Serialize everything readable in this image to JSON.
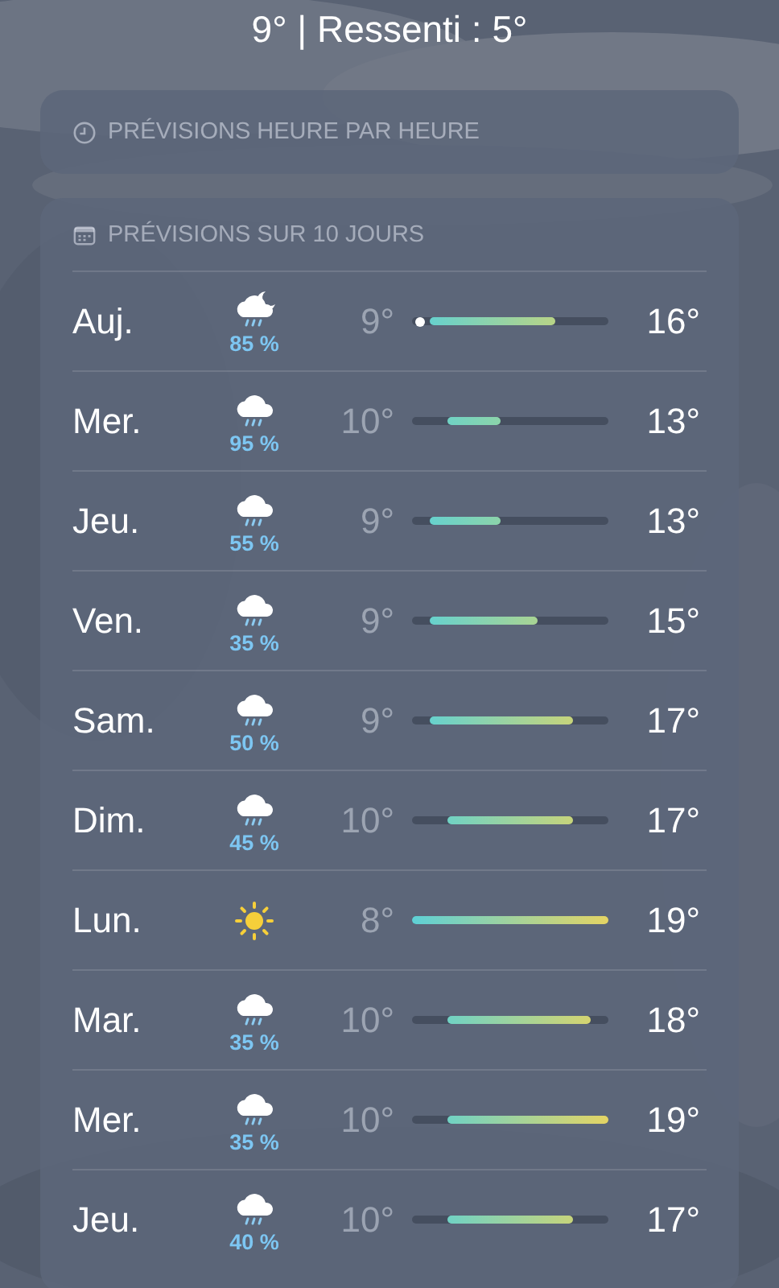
{
  "current": {
    "summary": "9° | Ressenti : 5°"
  },
  "hourly": {
    "title": "PRÉVISIONS HEURE PAR HEURE"
  },
  "daily": {
    "title": "PRÉVISIONS SUR 10 JOURS",
    "days": [
      {
        "day": "Auj.",
        "kind": "cloud-moon-rain",
        "precip": "85 %",
        "low": "9°",
        "high": "16°",
        "now_marker": true
      },
      {
        "day": "Mer.",
        "kind": "cloud-rain",
        "precip": "95 %",
        "low": "10°",
        "high": "13°",
        "now_marker": false
      },
      {
        "day": "Jeu.",
        "kind": "cloud-rain",
        "precip": "55 %",
        "low": "9°",
        "high": "13°",
        "now_marker": false
      },
      {
        "day": "Ven.",
        "kind": "cloud-rain",
        "precip": "35 %",
        "low": "9°",
        "high": "15°",
        "now_marker": false
      },
      {
        "day": "Sam.",
        "kind": "cloud-rain",
        "precip": "50 %",
        "low": "9°",
        "high": "17°",
        "now_marker": false
      },
      {
        "day": "Dim.",
        "kind": "cloud-rain",
        "precip": "45 %",
        "low": "10°",
        "high": "17°",
        "now_marker": false
      },
      {
        "day": "Lun.",
        "kind": "sun",
        "low": "8°",
        "high": "19°",
        "now_marker": false
      },
      {
        "day": "Mar.",
        "kind": "cloud-rain",
        "precip": "35 %",
        "low": "10°",
        "high": "18°",
        "now_marker": false
      },
      {
        "day": "Mer.",
        "kind": "cloud-rain",
        "precip": "35 %",
        "low": "10°",
        "high": "19°",
        "now_marker": false
      },
      {
        "day": "Jeu.",
        "kind": "cloud-rain",
        "precip": "40 %",
        "low": "10°",
        "high": "17°",
        "now_marker": false
      }
    ]
  }
}
